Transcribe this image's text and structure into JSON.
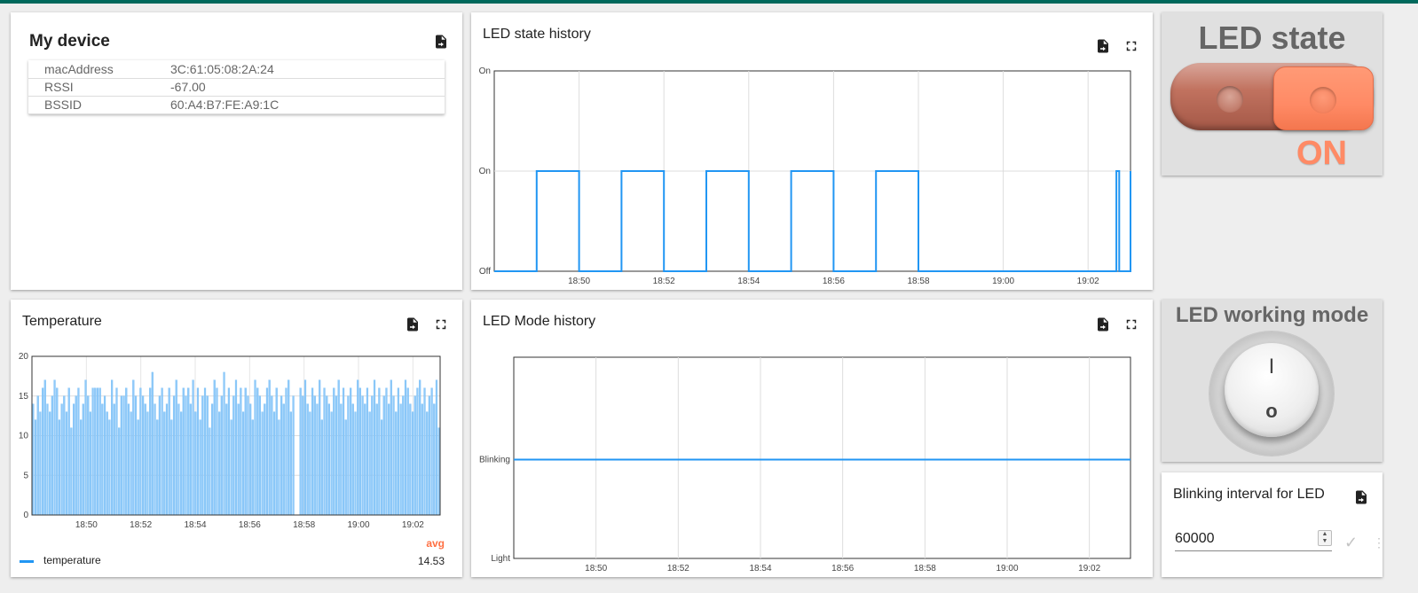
{
  "colors": {
    "header": "#00695c",
    "accent": "#ff8a65",
    "series": "#2196f3"
  },
  "device_card": {
    "title": "My device",
    "export_icon": "file-export-icon",
    "rows": [
      {
        "key": "macAddress",
        "value": "3C:61:05:08:2A:24"
      },
      {
        "key": "RSSI",
        "value": "-67.00"
      },
      {
        "key": "BSSID",
        "value": "60:A4:B7:FE:A9:1C"
      }
    ]
  },
  "led_history": {
    "title": "LED state history",
    "chart_data": {
      "type": "line",
      "x_unit": "time",
      "xlim": [
        "18:48",
        "19:03"
      ],
      "x_ticks": [
        "18:50",
        "18:52",
        "18:54",
        "18:56",
        "18:58",
        "19:00",
        "19:02"
      ],
      "y_ticks": [
        "Off",
        "On",
        "On"
      ],
      "ylim": [
        0,
        2
      ],
      "series": [
        {
          "step": true,
          "points": [
            [
              "18:48",
              0
            ],
            [
              "18:49",
              0
            ],
            [
              "18:49",
              1
            ],
            [
              "18:50",
              1
            ],
            [
              "18:50",
              0
            ],
            [
              "18:51",
              0
            ],
            [
              "18:51",
              1
            ],
            [
              "18:52",
              1
            ],
            [
              "18:52",
              0
            ],
            [
              "18:53",
              0
            ],
            [
              "18:53",
              1
            ],
            [
              "18:54",
              1
            ],
            [
              "18:54",
              0
            ],
            [
              "18:55",
              0
            ],
            [
              "18:55",
              1
            ],
            [
              "18:56",
              1
            ],
            [
              "18:56",
              0
            ],
            [
              "18:57",
              0
            ],
            [
              "18:57",
              1
            ],
            [
              "18:58",
              1
            ],
            [
              "18:58",
              0
            ],
            [
              "19:02:40",
              0
            ],
            [
              "19:02:40",
              1
            ],
            [
              "19:02:44",
              1
            ],
            [
              "19:02:44",
              0
            ],
            [
              "19:03",
              0
            ],
            [
              "19:03",
              1
            ]
          ]
        }
      ]
    }
  },
  "led_state": {
    "title": "LED state",
    "state_label": "ON",
    "is_on": true
  },
  "temperature": {
    "title": "Temperature",
    "chart_data": {
      "type": "bar",
      "xlim": [
        "18:48",
        "19:03"
      ],
      "x_ticks": [
        "18:50",
        "18:52",
        "18:54",
        "18:56",
        "18:58",
        "19:00",
        "19:02"
      ],
      "y_ticks": [
        0,
        5,
        10,
        15,
        20
      ],
      "ylim": [
        0,
        20
      ],
      "series": [
        {
          "name": "temperature",
          "values": [
            14,
            12,
            15,
            13,
            16,
            17,
            14,
            13,
            15,
            17,
            16,
            12,
            14,
            15,
            13,
            16,
            11,
            14,
            15,
            16,
            12,
            14,
            17,
            15,
            13,
            16,
            16,
            16,
            16,
            14,
            15,
            13,
            12,
            17,
            14,
            16,
            11,
            15,
            15,
            16,
            14,
            13,
            17,
            15,
            12,
            16,
            15,
            14,
            13,
            16,
            18,
            14,
            12,
            15,
            16,
            13,
            14,
            16,
            12,
            15,
            17,
            14,
            13,
            16,
            15,
            16,
            14,
            17,
            13,
            16,
            12,
            15,
            16,
            15,
            11,
            14,
            17,
            16,
            13,
            15,
            18,
            14,
            16,
            12,
            15,
            17,
            14,
            16,
            13,
            16,
            15,
            14,
            12,
            17,
            16,
            15,
            13,
            14,
            16,
            17,
            15,
            13,
            16,
            12,
            15,
            14,
            16,
            17,
            13,
            15,
            0,
            0,
            16,
            15,
            17,
            14,
            13,
            16,
            15,
            14,
            17,
            12,
            16,
            15,
            14,
            13,
            16,
            15,
            17,
            14,
            16,
            12,
            15,
            16,
            14,
            13,
            17,
            16,
            15,
            14,
            16,
            13,
            15,
            17,
            14,
            16,
            12,
            15,
            16,
            14,
            17,
            15,
            13,
            16,
            14,
            15,
            17,
            16,
            14,
            13,
            15,
            16,
            17,
            14,
            16,
            13,
            15,
            16,
            14,
            17,
            11
          ]
        }
      ]
    },
    "legend": {
      "avg_label": "avg",
      "series_name": "temperature",
      "avg_value": "14.53"
    }
  },
  "led_mode": {
    "title": "LED Mode history",
    "chart_data": {
      "type": "line",
      "xlim": [
        "18:48",
        "19:03"
      ],
      "x_ticks": [
        "18:50",
        "18:52",
        "18:54",
        "18:56",
        "18:58",
        "19:00",
        "19:02"
      ],
      "y_ticks": [
        "Light",
        "Blinking"
      ],
      "series": [
        {
          "points": [
            [
              "18:48",
              "Blinking"
            ],
            [
              "19:03",
              "Blinking"
            ]
          ]
        }
      ]
    }
  },
  "working_mode": {
    "title": "LED working mode",
    "on_symbol": "I",
    "off_symbol": "O"
  },
  "blink_interval": {
    "title": "Blinking interval for LED",
    "value": "60000"
  }
}
